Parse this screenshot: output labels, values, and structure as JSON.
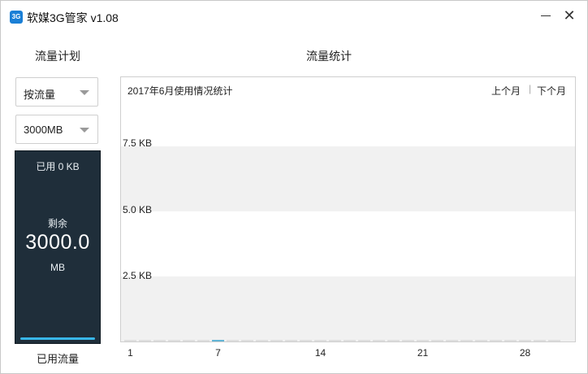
{
  "window": {
    "title": "软媒3G管家 v1.08",
    "icon_text": "3G",
    "minimize_icon": "minimize-icon",
    "close_icon": "close-icon",
    "close_glyph": "✕"
  },
  "plan": {
    "heading": "流量计划",
    "type_select": {
      "selected": "按流量"
    },
    "size_select": {
      "selected": "3000MB"
    },
    "used_text": "已用 0 KB",
    "remaining_label": "剩余",
    "remaining_value": "3000.0",
    "remaining_unit": "MB",
    "remaining_fraction": 1.0,
    "footer_label": "已用流量"
  },
  "stats": {
    "heading": "流量统计",
    "chart_title": "2017年6月使用情况统计",
    "prev_month": "上个月",
    "separator": "|",
    "next_month": "下个月"
  },
  "chart_data": {
    "type": "bar",
    "title": "2017年6月使用情况统计",
    "xlabel": "",
    "ylabel": "",
    "unit": "KB",
    "y_ticks": [
      "2.5 KB",
      "5.0 KB",
      "7.5 KB"
    ],
    "y_tick_values": [
      2.5,
      5.0,
      7.5
    ],
    "ylim": [
      0,
      10
    ],
    "x_ticks": [
      "1",
      "7",
      "14",
      "21",
      "28"
    ],
    "x_tick_days": [
      1,
      7,
      14,
      21,
      28
    ],
    "categories": [
      1,
      2,
      3,
      4,
      5,
      6,
      7,
      8,
      9,
      10,
      11,
      12,
      13,
      14,
      15,
      16,
      17,
      18,
      19,
      20,
      21,
      22,
      23,
      24,
      25,
      26,
      27,
      28,
      29,
      30
    ],
    "values": [
      0,
      0,
      0,
      0,
      0,
      0,
      0,
      0,
      0,
      0,
      0,
      0,
      0,
      0,
      0,
      0,
      0,
      0,
      0,
      0,
      0,
      0,
      0,
      0,
      0,
      0,
      0,
      0,
      0,
      0
    ],
    "highlight_day": 7,
    "colors": {
      "bar": "#dedede",
      "highlight": "#63b5d6",
      "band": "#f1f1f1"
    },
    "grid": true,
    "legend": "none"
  }
}
